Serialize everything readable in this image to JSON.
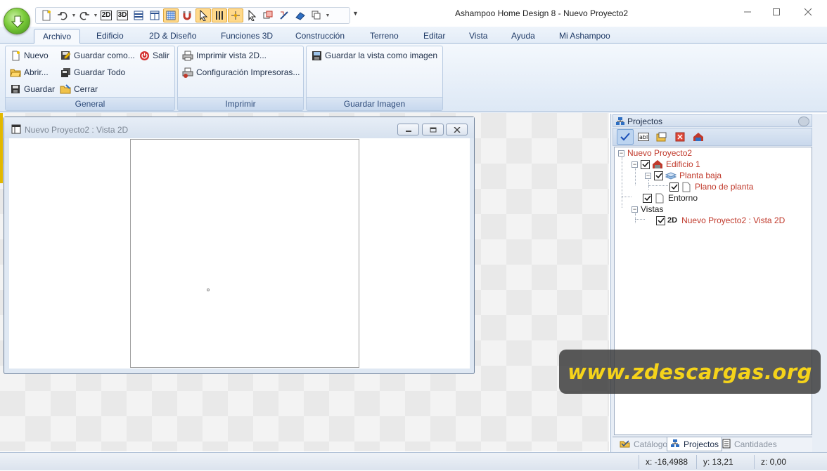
{
  "window": {
    "title": "Ashampoo Home Design 8 - Nuevo Proyecto2",
    "controls": [
      "minimize",
      "maximize",
      "close"
    ]
  },
  "quick_access": {
    "icons": [
      "new-document-icon",
      "undo-icon",
      "redo-icon",
      "view-2d-icon",
      "view-3d-icon",
      "layout-horizontal-icon",
      "layout-split-icon",
      "grid-icon",
      "magnet-icon",
      "select-arrow-icon",
      "guides-icon",
      "snap-icon",
      "pointer-icon",
      "measure-icon",
      "pick-icon",
      "material-icon",
      "copy-icon"
    ],
    "view_2d_label": "2D",
    "view_3d_label": "3D"
  },
  "ribbon": {
    "tabs": [
      "Archivo",
      "Edificio",
      "2D & Diseño",
      "Funciones 3D",
      "Construcción",
      "Terreno",
      "Editar",
      "Vista",
      "Ayuda",
      "Mi Ashampoo"
    ],
    "active_tab": "Archivo",
    "groups": {
      "general": {
        "label": "General",
        "new": "Nuevo",
        "open": "Abrir...",
        "save": "Guardar",
        "save_as": "Guardar como...",
        "save_all": "Guardar Todo",
        "close": "Cerrar",
        "exit": "Salir"
      },
      "print": {
        "label": "Imprimir",
        "print_2d": "Imprimir vista 2D...",
        "printer_setup": "Configuración Impresoras..."
      },
      "save_image": {
        "label": "Guardar Imagen",
        "save_view": "Guardar la vista como imagen"
      }
    }
  },
  "mdi_window": {
    "title": "Nuevo Proyecto2 : Vista 2D"
  },
  "projects_panel": {
    "title": "Projectos",
    "tree": {
      "root": "Nuevo Proyecto2",
      "building": "Edificio 1",
      "floor": "Planta baja",
      "floor_plan": "Plano de planta",
      "surroundings": "Entorno",
      "views": "Vistas",
      "view_badge": "2D",
      "view_item": "Nuevo Proyecto2 : Vista 2D"
    },
    "tabs": {
      "catalog": "Catálogo",
      "projects": "Projectos",
      "quantities": "Cantidades"
    }
  },
  "watermark": "www.zdescargas.org",
  "statusbar": {
    "x": "x: -16,4988",
    "y": "y: 13,21",
    "z": "z: 0,00"
  },
  "colors": {
    "accent_tree_text": "#c0392b",
    "ribbon_blue": "#dde8f5",
    "watermark_text": "#f5d31a"
  }
}
